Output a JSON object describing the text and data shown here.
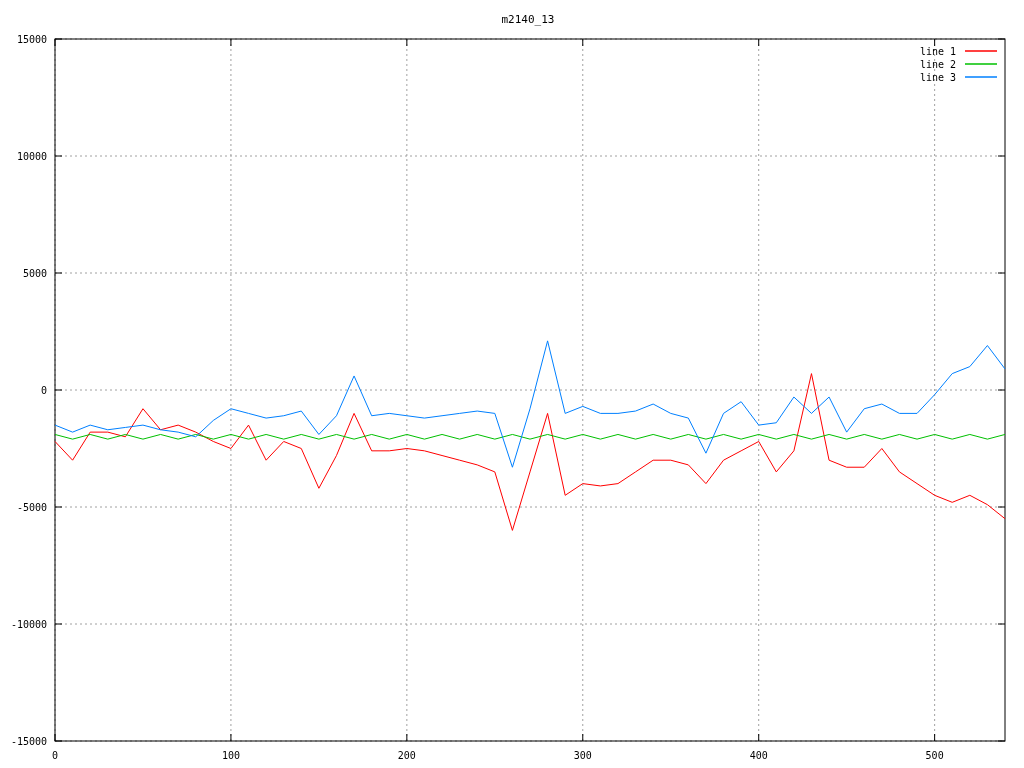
{
  "chart_data": {
    "type": "line",
    "title": "m2140_13",
    "x": [
      0,
      10,
      20,
      30,
      40,
      50,
      60,
      70,
      80,
      90,
      100,
      110,
      120,
      130,
      140,
      150,
      160,
      170,
      180,
      190,
      200,
      210,
      220,
      230,
      240,
      250,
      260,
      270,
      280,
      290,
      300,
      310,
      320,
      330,
      340,
      350,
      360,
      370,
      380,
      390,
      400,
      410,
      420,
      430,
      440,
      450,
      460,
      470,
      480,
      490,
      500,
      510,
      520,
      530,
      540
    ],
    "series": [
      {
        "name": "line 1",
        "color": "#ff0000",
        "values": [
          -2200,
          -3000,
          -1800,
          -1800,
          -2000,
          -800,
          -1700,
          -1500,
          -1800,
          -2200,
          -2500,
          -1500,
          -3000,
          -2200,
          -2500,
          -4200,
          -2800,
          -1000,
          -2600,
          -2600,
          -2500,
          -2600,
          -2800,
          -3000,
          -3200,
          -3500,
          -6000,
          -3500,
          -1000,
          -4500,
          -4000,
          -4100,
          -4000,
          -3500,
          -3000,
          -3000,
          -3200,
          -4000,
          -3000,
          -2600,
          -2200,
          -3500,
          -2600,
          700,
          -3000,
          -3300,
          -3300,
          -2500,
          -3500,
          -4000,
          -4500,
          -4800,
          -4500,
          -4900,
          -5500
        ]
      },
      {
        "name": "line 2",
        "color": "#00c000",
        "values": [
          -1900,
          -2100,
          -1900,
          -2100,
          -1900,
          -2100,
          -1900,
          -2100,
          -1900,
          -2100,
          -1900,
          -2100,
          -1900,
          -2100,
          -1900,
          -2100,
          -1900,
          -2100,
          -1900,
          -2100,
          -1900,
          -2100,
          -1900,
          -2100,
          -1900,
          -2100,
          -1900,
          -2100,
          -1900,
          -2100,
          -1900,
          -2100,
          -1900,
          -2100,
          -1900,
          -2100,
          -1900,
          -2100,
          -1900,
          -2100,
          -1900,
          -2100,
          -1900,
          -2100,
          -1900,
          -2100,
          -1900,
          -2100,
          -1900,
          -2100,
          -1900,
          -2100,
          -1900,
          -2100,
          -1900
        ]
      },
      {
        "name": "line 3",
        "color": "#0080ff",
        "values": [
          -1500,
          -1800,
          -1500,
          -1700,
          -1600,
          -1500,
          -1700,
          -1800,
          -2000,
          -1300,
          -800,
          -1000,
          -1200,
          -1100,
          -900,
          -1900,
          -1100,
          600,
          -1100,
          -1000,
          -1100,
          -1200,
          -1100,
          -1000,
          -900,
          -1000,
          -3300,
          -800,
          2100,
          -1000,
          -700,
          -1000,
          -1000,
          -900,
          -600,
          -1000,
          -1200,
          -2700,
          -1000,
          -500,
          -1500,
          -1400,
          -300,
          -1000,
          -300,
          -1800,
          -800,
          -600,
          -1000,
          -1000,
          -200,
          700,
          1000,
          1900,
          900
        ]
      }
    ],
    "xlim": [
      0,
      540
    ],
    "ylim": [
      -15000,
      15000
    ],
    "xticks": [
      0,
      100,
      200,
      300,
      400,
      500
    ],
    "yticks": [
      -15000,
      -10000,
      -5000,
      0,
      5000,
      10000,
      15000
    ],
    "grid": true,
    "legend": true
  }
}
